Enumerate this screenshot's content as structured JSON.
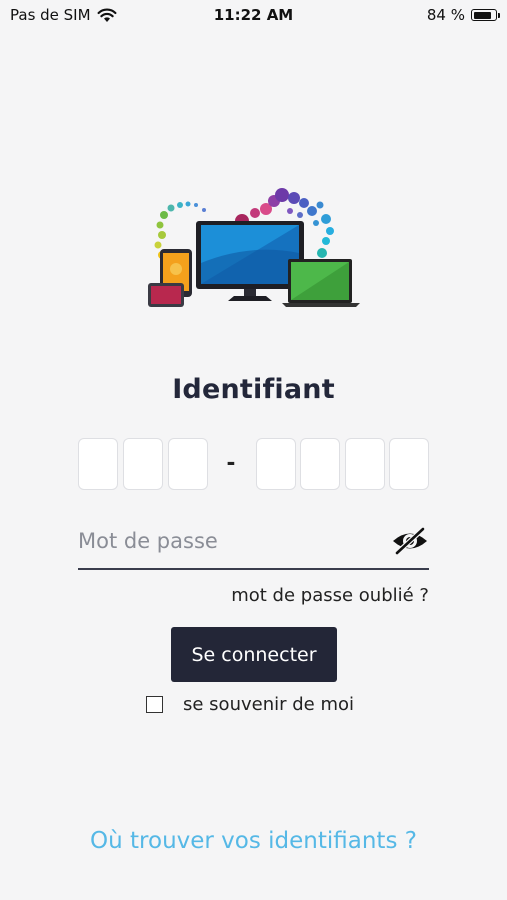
{
  "status_bar": {
    "carrier": "Pas de SIM",
    "time": "11:22 AM",
    "battery": "84 %",
    "battery_level": 0.84
  },
  "hero": {
    "icon": "multi-device-illustration-icon"
  },
  "login": {
    "title": "Identifiant",
    "id_separator": "-",
    "password_placeholder": "Mot de passe",
    "password_toggle_icon": "eye-slash-icon",
    "forgot_password": "mot de passe oublié ?",
    "connect_button": "Se connecter",
    "remember_me": "se souvenir de moi",
    "where_to_find": "Où trouver vos identifiants ?"
  },
  "colors": {
    "background": "#f5f5f6",
    "primary_button": "#232637",
    "link": "#55b8e6"
  }
}
